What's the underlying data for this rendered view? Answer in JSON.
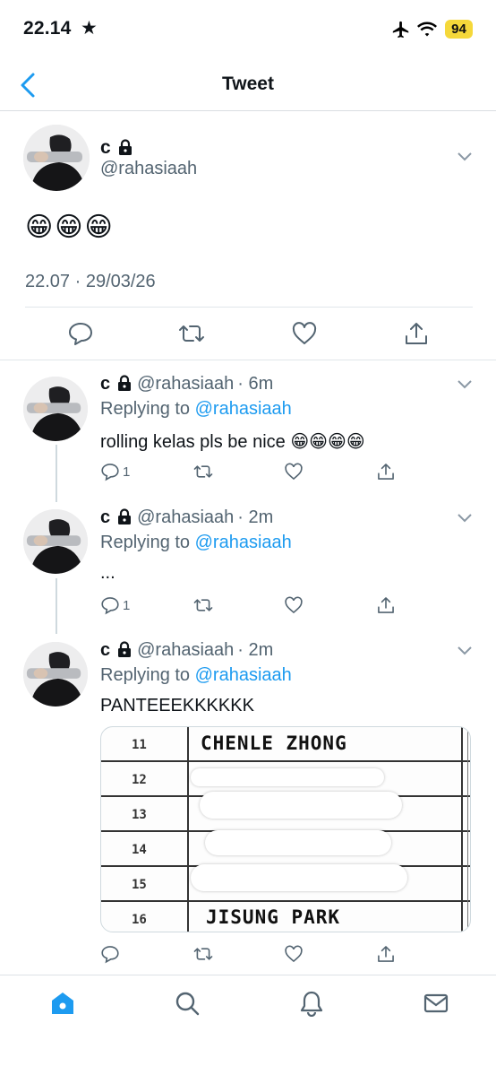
{
  "status_bar": {
    "time": "22.14",
    "star": "★",
    "battery": "94"
  },
  "nav": {
    "title": "Tweet",
    "back_icon": "chevron-left-icon"
  },
  "main_tweet": {
    "name": "c",
    "handle": "@rahasiaah",
    "content": "😁😁😁",
    "timestamp": "22.07 · 29/03/26"
  },
  "replies": [
    {
      "name": "c",
      "handle": "@rahasiaah",
      "time": "· 6m",
      "replying_prefix": "Replying to",
      "replying_to": "@rahasiaah",
      "text": "rolling kelas pls be nice 😁😁😁😁",
      "reply_count": "1"
    },
    {
      "name": "c",
      "handle": "@rahasiaah",
      "time": "· 2m",
      "replying_prefix": "Replying to",
      "replying_to": "@rahasiaah",
      "text": "...",
      "reply_count": "1"
    },
    {
      "name": "c",
      "handle": "@rahasiaah",
      "time": "· 2m",
      "replying_prefix": "Replying to",
      "replying_to": "@rahasiaah",
      "text": "PANTEEEKKKKKK",
      "reply_count": ""
    }
  ],
  "attachment": {
    "rows": [
      "11",
      "12",
      "13",
      "14",
      "15",
      "16"
    ],
    "names": {
      "11": "CHENLE ZHONG",
      "16": "JISUNG PARK"
    }
  },
  "colors": {
    "accent": "#1d9bf0",
    "secondary_text": "#536471",
    "battery": "#f5d83a"
  }
}
